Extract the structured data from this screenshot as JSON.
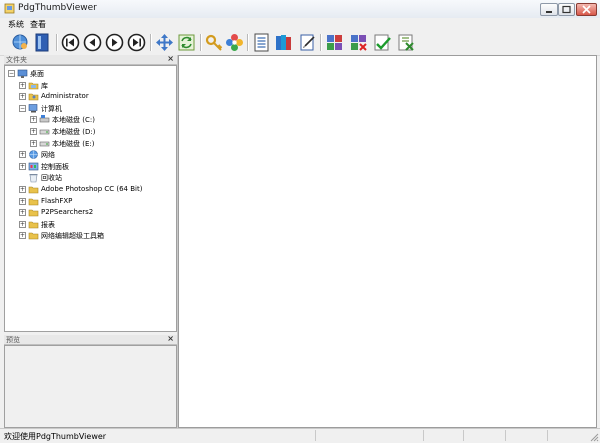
{
  "window": {
    "title": "PdgThumbViewer"
  },
  "menu": {
    "items": [
      "系统",
      "查看"
    ]
  },
  "toolbar": {
    "buttons": [
      {
        "icon": "globe-user-icon",
        "label": ""
      },
      {
        "icon": "book-icon",
        "label": ""
      },
      {
        "icon": "first-icon",
        "label": ""
      },
      {
        "icon": "previous-icon",
        "label": ""
      },
      {
        "icon": "next-icon",
        "label": ""
      },
      {
        "icon": "last-icon",
        "label": ""
      },
      {
        "icon": "move-arrows-icon",
        "label": ""
      },
      {
        "icon": "refresh-icon",
        "label": ""
      },
      {
        "icon": "key-icon",
        "label": ""
      },
      {
        "icon": "flower-icon",
        "label": ""
      },
      {
        "icon": "document-list-icon",
        "label": ""
      },
      {
        "icon": "books-icon",
        "label": ""
      },
      {
        "icon": "edit-document-icon",
        "label": ""
      },
      {
        "icon": "puzzle-icon",
        "label": ""
      },
      {
        "icon": "puzzle-delete-icon",
        "label": ""
      },
      {
        "icon": "check-icon",
        "label": ""
      },
      {
        "icon": "document-delete-icon",
        "label": ""
      }
    ]
  },
  "folder_panel": {
    "title": "文件夹",
    "close": "×",
    "tree": [
      {
        "label": "桌面",
        "depth": 0,
        "toggle": "⊟",
        "icon": "desktop-icon"
      },
      {
        "label": "库",
        "depth": 1,
        "toggle": "⊞",
        "icon": "library-folder-icon"
      },
      {
        "label": "Administrator",
        "depth": 1,
        "toggle": "⊞",
        "icon": "user-folder-icon"
      },
      {
        "label": "计算机",
        "depth": 1,
        "toggle": "⊟",
        "icon": "computer-icon"
      },
      {
        "label": "本地磁盘 (C:)",
        "depth": 2,
        "toggle": "⊞",
        "icon": "system-drive-icon"
      },
      {
        "label": "本地磁盘 (D:)",
        "depth": 2,
        "toggle": "⊞",
        "icon": "drive-icon"
      },
      {
        "label": "本地磁盘 (E:)",
        "depth": 2,
        "toggle": "⊞",
        "icon": "drive-icon"
      },
      {
        "label": "网络",
        "depth": 1,
        "toggle": "⊞",
        "icon": "network-icon"
      },
      {
        "label": "控制面板",
        "depth": 1,
        "toggle": "⊞",
        "icon": "control-panel-icon"
      },
      {
        "label": "回收站",
        "depth": 1,
        "toggle": "",
        "icon": "recycle-bin-icon"
      },
      {
        "label": "Adobe Photoshop CC (64 Bit)",
        "depth": 1,
        "toggle": "⊞",
        "icon": "folder-icon"
      },
      {
        "label": "FlashFXP",
        "depth": 1,
        "toggle": "⊞",
        "icon": "folder-icon"
      },
      {
        "label": "P2PSearchers2",
        "depth": 1,
        "toggle": "⊞",
        "icon": "folder-icon"
      },
      {
        "label": "报表",
        "depth": 1,
        "toggle": "⊞",
        "icon": "folder-icon"
      },
      {
        "label": "网络编辑超级工具箱",
        "depth": 1,
        "toggle": "⊞",
        "icon": "folder-icon"
      }
    ]
  },
  "preview_panel": {
    "title": "预览",
    "close": "×"
  },
  "status": {
    "text": "欢迎使用PdgThumbViewer"
  },
  "colors": {
    "folder": "#e9c24b",
    "accent": "#2f5fb3",
    "close": "#d8584a"
  }
}
